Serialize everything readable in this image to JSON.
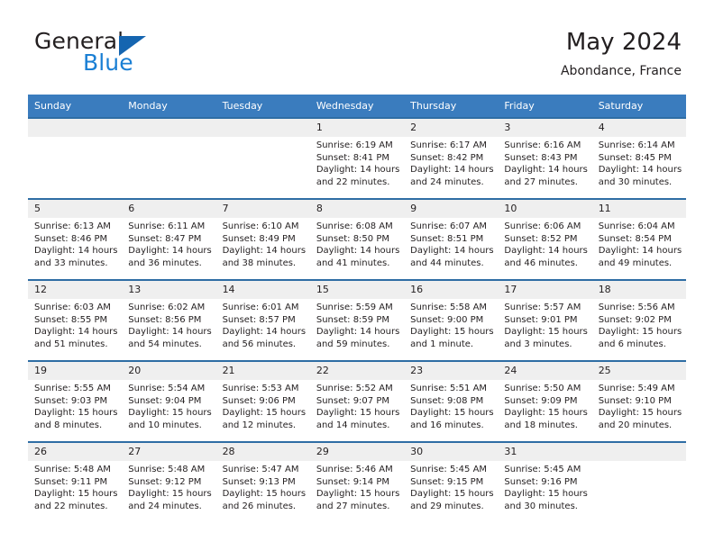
{
  "brand": {
    "word1": "General",
    "word2": "Blue",
    "flag_icon": "triangle-flag-icon"
  },
  "header": {
    "title": "May 2024",
    "subtitle": "Abondance, France"
  },
  "calendar": {
    "accent_header_color": "#3a7cbe",
    "accent_border_color": "#2e6da4",
    "daynum_band_color": "#efefef",
    "weekdays": [
      "Sunday",
      "Monday",
      "Tuesday",
      "Wednesday",
      "Thursday",
      "Friday",
      "Saturday"
    ],
    "labels": {
      "sunrise": "Sunrise:",
      "sunset": "Sunset:",
      "daylight": "Daylight:"
    },
    "weeks": [
      [
        {
          "day": "",
          "empty": true
        },
        {
          "day": "",
          "empty": true
        },
        {
          "day": "",
          "empty": true
        },
        {
          "day": "1",
          "sunrise": "Sunrise: 6:19 AM",
          "sunset": "Sunset: 8:41 PM",
          "daylight1": "Daylight: 14 hours",
          "daylight2": "and 22 minutes."
        },
        {
          "day": "2",
          "sunrise": "Sunrise: 6:17 AM",
          "sunset": "Sunset: 8:42 PM",
          "daylight1": "Daylight: 14 hours",
          "daylight2": "and 24 minutes."
        },
        {
          "day": "3",
          "sunrise": "Sunrise: 6:16 AM",
          "sunset": "Sunset: 8:43 PM",
          "daylight1": "Daylight: 14 hours",
          "daylight2": "and 27 minutes."
        },
        {
          "day": "4",
          "sunrise": "Sunrise: 6:14 AM",
          "sunset": "Sunset: 8:45 PM",
          "daylight1": "Daylight: 14 hours",
          "daylight2": "and 30 minutes."
        }
      ],
      [
        {
          "day": "5",
          "sunrise": "Sunrise: 6:13 AM",
          "sunset": "Sunset: 8:46 PM",
          "daylight1": "Daylight: 14 hours",
          "daylight2": "and 33 minutes."
        },
        {
          "day": "6",
          "sunrise": "Sunrise: 6:11 AM",
          "sunset": "Sunset: 8:47 PM",
          "daylight1": "Daylight: 14 hours",
          "daylight2": "and 36 minutes."
        },
        {
          "day": "7",
          "sunrise": "Sunrise: 6:10 AM",
          "sunset": "Sunset: 8:49 PM",
          "daylight1": "Daylight: 14 hours",
          "daylight2": "and 38 minutes."
        },
        {
          "day": "8",
          "sunrise": "Sunrise: 6:08 AM",
          "sunset": "Sunset: 8:50 PM",
          "daylight1": "Daylight: 14 hours",
          "daylight2": "and 41 minutes."
        },
        {
          "day": "9",
          "sunrise": "Sunrise: 6:07 AM",
          "sunset": "Sunset: 8:51 PM",
          "daylight1": "Daylight: 14 hours",
          "daylight2": "and 44 minutes."
        },
        {
          "day": "10",
          "sunrise": "Sunrise: 6:06 AM",
          "sunset": "Sunset: 8:52 PM",
          "daylight1": "Daylight: 14 hours",
          "daylight2": "and 46 minutes."
        },
        {
          "day": "11",
          "sunrise": "Sunrise: 6:04 AM",
          "sunset": "Sunset: 8:54 PM",
          "daylight1": "Daylight: 14 hours",
          "daylight2": "and 49 minutes."
        }
      ],
      [
        {
          "day": "12",
          "sunrise": "Sunrise: 6:03 AM",
          "sunset": "Sunset: 8:55 PM",
          "daylight1": "Daylight: 14 hours",
          "daylight2": "and 51 minutes."
        },
        {
          "day": "13",
          "sunrise": "Sunrise: 6:02 AM",
          "sunset": "Sunset: 8:56 PM",
          "daylight1": "Daylight: 14 hours",
          "daylight2": "and 54 minutes."
        },
        {
          "day": "14",
          "sunrise": "Sunrise: 6:01 AM",
          "sunset": "Sunset: 8:57 PM",
          "daylight1": "Daylight: 14 hours",
          "daylight2": "and 56 minutes."
        },
        {
          "day": "15",
          "sunrise": "Sunrise: 5:59 AM",
          "sunset": "Sunset: 8:59 PM",
          "daylight1": "Daylight: 14 hours",
          "daylight2": "and 59 minutes."
        },
        {
          "day": "16",
          "sunrise": "Sunrise: 5:58 AM",
          "sunset": "Sunset: 9:00 PM",
          "daylight1": "Daylight: 15 hours",
          "daylight2": "and 1 minute."
        },
        {
          "day": "17",
          "sunrise": "Sunrise: 5:57 AM",
          "sunset": "Sunset: 9:01 PM",
          "daylight1": "Daylight: 15 hours",
          "daylight2": "and 3 minutes."
        },
        {
          "day": "18",
          "sunrise": "Sunrise: 5:56 AM",
          "sunset": "Sunset: 9:02 PM",
          "daylight1": "Daylight: 15 hours",
          "daylight2": "and 6 minutes."
        }
      ],
      [
        {
          "day": "19",
          "sunrise": "Sunrise: 5:55 AM",
          "sunset": "Sunset: 9:03 PM",
          "daylight1": "Daylight: 15 hours",
          "daylight2": "and 8 minutes."
        },
        {
          "day": "20",
          "sunrise": "Sunrise: 5:54 AM",
          "sunset": "Sunset: 9:04 PM",
          "daylight1": "Daylight: 15 hours",
          "daylight2": "and 10 minutes."
        },
        {
          "day": "21",
          "sunrise": "Sunrise: 5:53 AM",
          "sunset": "Sunset: 9:06 PM",
          "daylight1": "Daylight: 15 hours",
          "daylight2": "and 12 minutes."
        },
        {
          "day": "22",
          "sunrise": "Sunrise: 5:52 AM",
          "sunset": "Sunset: 9:07 PM",
          "daylight1": "Daylight: 15 hours",
          "daylight2": "and 14 minutes."
        },
        {
          "day": "23",
          "sunrise": "Sunrise: 5:51 AM",
          "sunset": "Sunset: 9:08 PM",
          "daylight1": "Daylight: 15 hours",
          "daylight2": "and 16 minutes."
        },
        {
          "day": "24",
          "sunrise": "Sunrise: 5:50 AM",
          "sunset": "Sunset: 9:09 PM",
          "daylight1": "Daylight: 15 hours",
          "daylight2": "and 18 minutes."
        },
        {
          "day": "25",
          "sunrise": "Sunrise: 5:49 AM",
          "sunset": "Sunset: 9:10 PM",
          "daylight1": "Daylight: 15 hours",
          "daylight2": "and 20 minutes."
        }
      ],
      [
        {
          "day": "26",
          "sunrise": "Sunrise: 5:48 AM",
          "sunset": "Sunset: 9:11 PM",
          "daylight1": "Daylight: 15 hours",
          "daylight2": "and 22 minutes."
        },
        {
          "day": "27",
          "sunrise": "Sunrise: 5:48 AM",
          "sunset": "Sunset: 9:12 PM",
          "daylight1": "Daylight: 15 hours",
          "daylight2": "and 24 minutes."
        },
        {
          "day": "28",
          "sunrise": "Sunrise: 5:47 AM",
          "sunset": "Sunset: 9:13 PM",
          "daylight1": "Daylight: 15 hours",
          "daylight2": "and 26 minutes."
        },
        {
          "day": "29",
          "sunrise": "Sunrise: 5:46 AM",
          "sunset": "Sunset: 9:14 PM",
          "daylight1": "Daylight: 15 hours",
          "daylight2": "and 27 minutes."
        },
        {
          "day": "30",
          "sunrise": "Sunrise: 5:45 AM",
          "sunset": "Sunset: 9:15 PM",
          "daylight1": "Daylight: 15 hours",
          "daylight2": "and 29 minutes."
        },
        {
          "day": "31",
          "sunrise": "Sunrise: 5:45 AM",
          "sunset": "Sunset: 9:16 PM",
          "daylight1": "Daylight: 15 hours",
          "daylight2": "and 30 minutes."
        },
        {
          "day": "",
          "empty": true
        }
      ]
    ]
  }
}
